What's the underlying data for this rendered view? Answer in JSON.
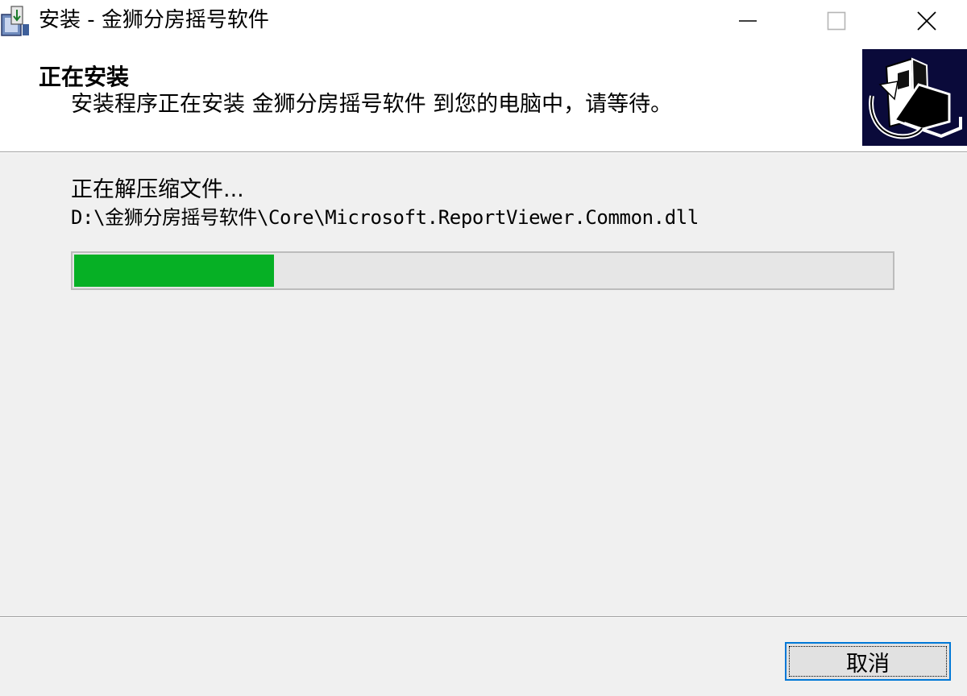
{
  "window": {
    "title": "安装 - 金狮分房摇号软件",
    "icons": {
      "app": "installer-icon",
      "minimize": "minimize-icon",
      "maximize": "maximize-icon",
      "close": "close-icon"
    }
  },
  "header": {
    "title": "正在安装",
    "description": "安装程序正在安装 金狮分房摇号软件 到您的电脑中，请等待。",
    "image_icon": "computer-install-icon"
  },
  "status": {
    "text": "正在解压缩文件...",
    "file": "D:\\金狮分房摇号软件\\Core\\Microsoft.ReportViewer.Common.dll"
  },
  "progress": {
    "fraction": 0.245,
    "fill_color": "#06b025"
  },
  "buttons": {
    "cancel_label": "取消"
  }
}
